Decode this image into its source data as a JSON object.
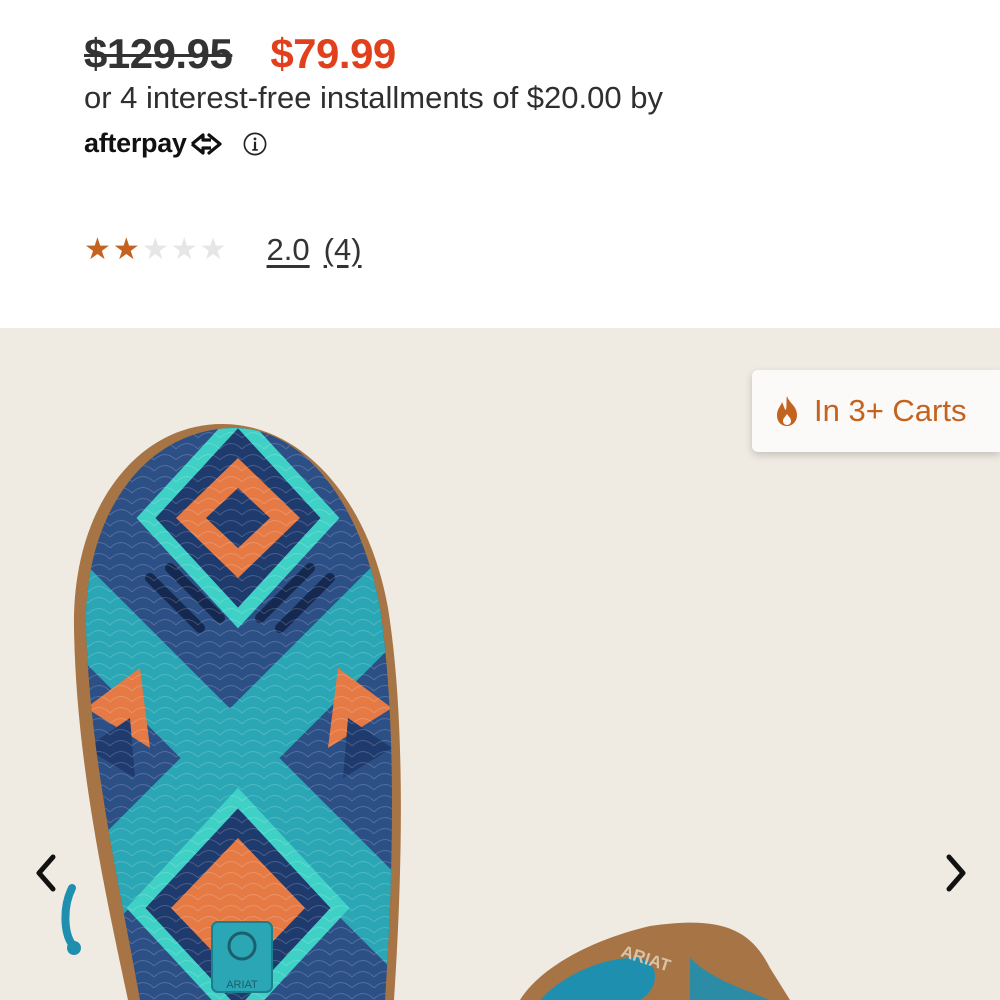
{
  "pricing": {
    "original_price": "$129.95",
    "sale_price": "$79.99",
    "installments_text": "or 4 interest-free installments of $20.00 by",
    "provider_logo_text": "afterpay"
  },
  "rating": {
    "value": "2.0",
    "count": "(4)",
    "stars_filled": 2,
    "stars_total": 5
  },
  "gallery": {
    "badge_text": "In 3+ Carts",
    "badge_icon": "flame-icon",
    "sole_logo_text": "ARIAT",
    "shoe_logo_text": "ARIAT"
  },
  "colors": {
    "sale": "#e2401c",
    "accent": "#c4621f",
    "star_off": "#e6e6e6",
    "gallery_bg": "#efebe3"
  }
}
